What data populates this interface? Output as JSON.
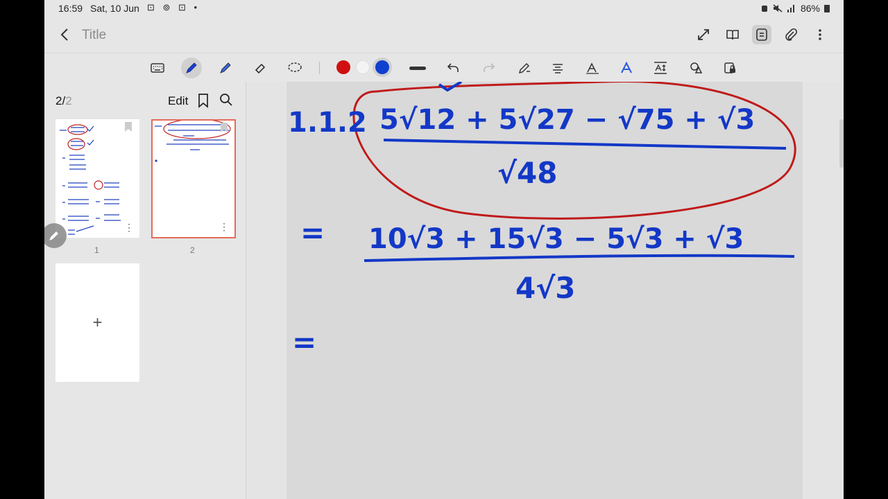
{
  "status_bar": {
    "time": "16:59",
    "date": "Sat, 10 Jun",
    "notification_icons": "⊡ ⊚ ⊡ •",
    "battery": "86%"
  },
  "header": {
    "title": "Title"
  },
  "toolbar": {
    "icons": [
      "keyboard-icon",
      "pen-icon",
      "highlighter-icon",
      "eraser-icon",
      "lasso-icon",
      "red-color",
      "white-color",
      "blue-color",
      "stroke-width-icon",
      "undo-icon",
      "redo-icon",
      "pen-to-text-icon",
      "align-icon",
      "handwriting-to-text-icon",
      "text-style-icon",
      "text-spacing-icon",
      "shapes-icon",
      "lock-icon"
    ],
    "colors": {
      "red": "#d01010",
      "white": "#f4f4f4",
      "blue": "#1040d0"
    }
  },
  "sidebar": {
    "current_page": "2",
    "page_separator": "/",
    "total_pages": "2",
    "edit_label": "Edit",
    "thumbnails": [
      {
        "label": "1"
      },
      {
        "label": "2"
      }
    ],
    "add_page_label": "+"
  },
  "note": {
    "problem_number": "1.1.2",
    "line1_numerator": "5√12 + 5√27 − √75 + √3",
    "line1_denominator": "√48",
    "eq1": "=",
    "line2_numerator": "10√3 + 15√3 − 5√3 + √3",
    "line2_denominator": "4√3",
    "eq2": "=",
    "ink_color": "#1338c7",
    "circle_color": "#c01a1a"
  }
}
